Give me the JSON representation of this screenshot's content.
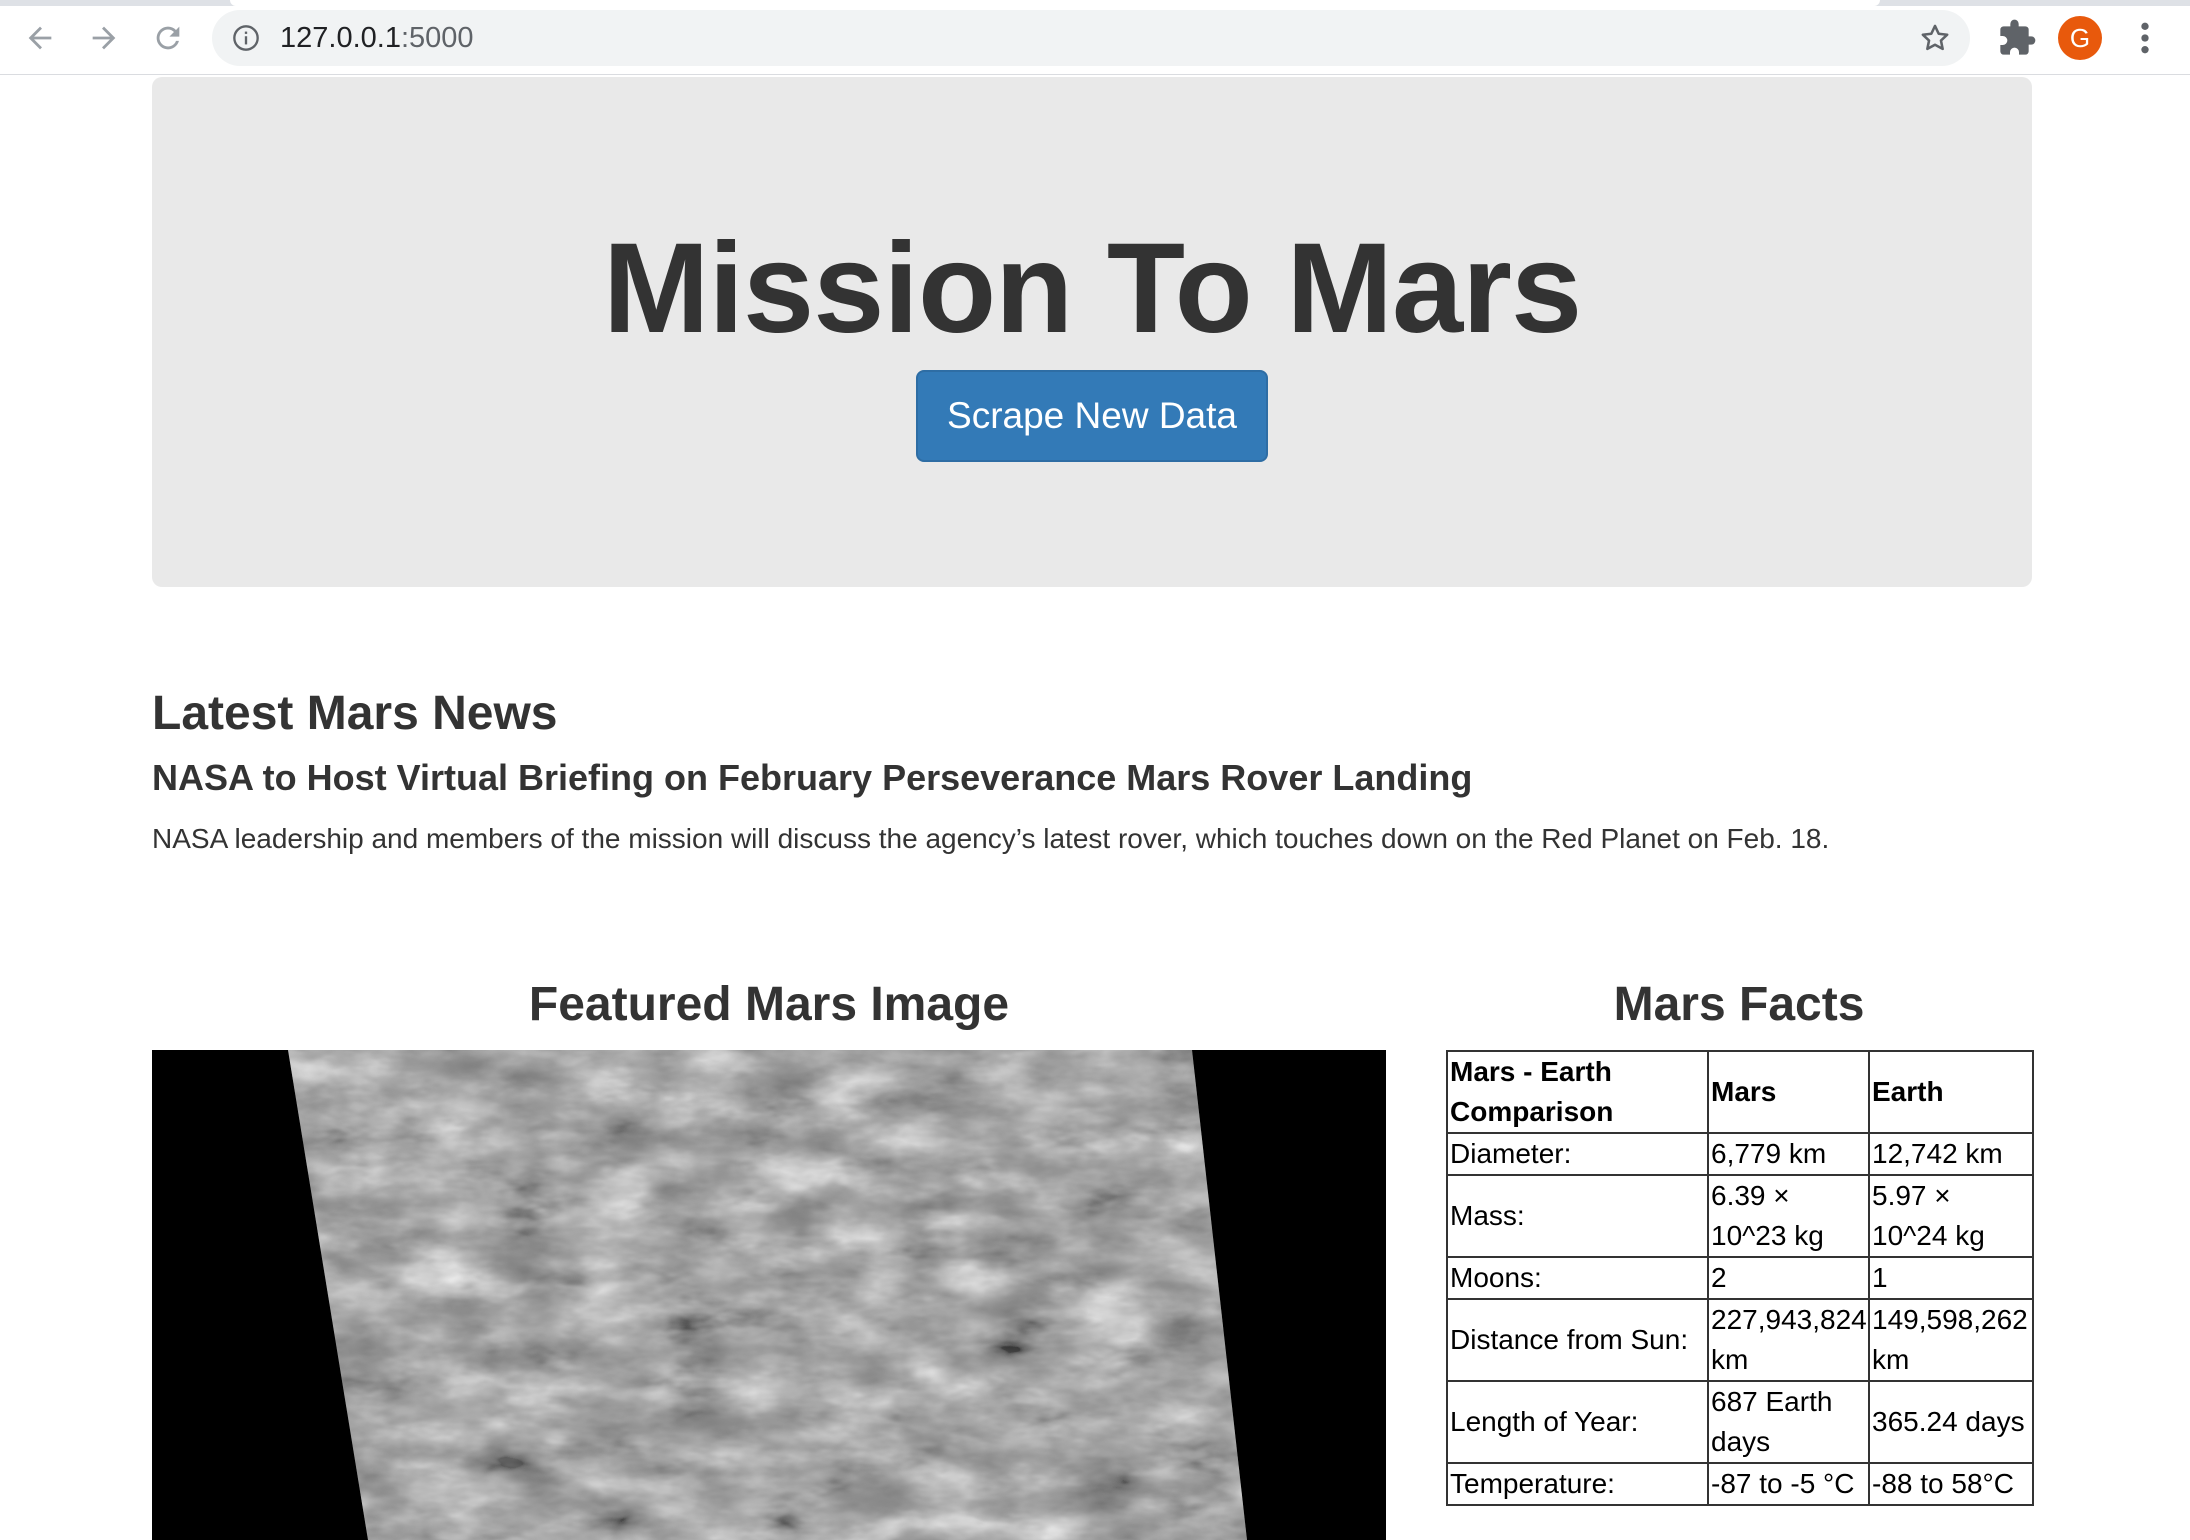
{
  "browser": {
    "url_host": "127.0.0.1",
    "url_port": ":5000",
    "avatar_letter": "G"
  },
  "jumbotron": {
    "title": "Mission To Mars",
    "button_label": "Scrape New Data",
    "button_color": "#337ab7"
  },
  "news": {
    "heading": "Latest Mars News",
    "title": "NASA to Host Virtual Briefing on February Perseverance Mars Rover Landing",
    "teaser": "NASA leadership and members of the mission will discuss the agency’s latest rover, which touches down on the Red Planet on Feb. 18."
  },
  "featured": {
    "heading": "Featured Mars Image"
  },
  "facts": {
    "heading": "Mars Facts",
    "header": [
      "Mars - Earth Comparison",
      "Mars",
      "Earth"
    ],
    "rows": [
      [
        "Diameter:",
        "6,779 km",
        "12,742 km"
      ],
      [
        "Mass:",
        "6.39 × 10^23 kg",
        "5.97 × 10^24 kg"
      ],
      [
        "Moons:",
        "2",
        "1"
      ],
      [
        "Distance from Sun:",
        "227,943,824 km",
        "149,598,262 km"
      ],
      [
        "Length of Year:",
        "687 Earth days",
        "365.24 days"
      ],
      [
        "Temperature:",
        "-87 to -5 °C",
        "-88 to 58°C"
      ]
    ]
  }
}
